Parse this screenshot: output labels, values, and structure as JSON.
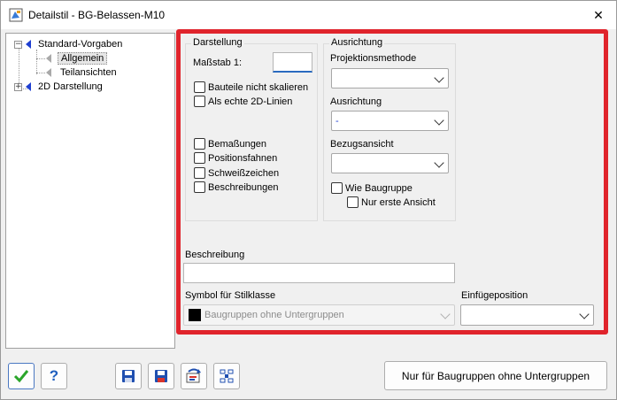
{
  "window": {
    "title": "Detailstil - BG-Belassen-M10",
    "close_glyph": "✕"
  },
  "tree": {
    "items": [
      {
        "label": "Standard-Vorgaben",
        "expander": "−"
      },
      {
        "label": "Allgemein"
      },
      {
        "label": "Teilansichten"
      },
      {
        "label": "2D Darstellung",
        "expander": "+"
      }
    ]
  },
  "darstellung": {
    "group_label": "Darstellung",
    "massstab_label": "Maßstab 1:",
    "massstab_value": "",
    "checkboxes": [
      {
        "label": "Bauteile nicht skalieren",
        "checked": false
      },
      {
        "label": "Als echte 2D-Linien",
        "checked": false
      },
      {
        "label": "Bemaßungen",
        "checked": false
      },
      {
        "label": "Positionsfahnen",
        "checked": false
      },
      {
        "label": "Schweißzeichen",
        "checked": false
      },
      {
        "label": "Beschreibungen",
        "checked": false
      }
    ]
  },
  "ausrichtung": {
    "group_label": "Ausrichtung",
    "projektionsmethode_label": "Projektionsmethode",
    "projektionsmethode_value": "",
    "ausrichtung_label": "Ausrichtung",
    "ausrichtung_value": "-",
    "bezugsansicht_label": "Bezugsansicht",
    "bezugsansicht_value": "",
    "wie_baugruppe_label": "Wie Baugruppe",
    "nur_erste_ansicht_label": "Nur erste Ansicht"
  },
  "beschreibung": {
    "label": "Beschreibung",
    "value": ""
  },
  "symbol": {
    "label": "Symbol für Stilklasse",
    "value": "Baugruppen ohne Untergruppen",
    "swatch_color": "#000000"
  },
  "einfuegeposition": {
    "label": "Einfügeposition",
    "value": ""
  },
  "footer": {
    "ok_icon": "checkmark-icon",
    "help_label": "?",
    "action_button_label": "Nur für Baugruppen ohne Untergruppen"
  },
  "colors": {
    "highlight_frame": "#e0242c",
    "tree_triangle": "#1f3fd1",
    "ok_check": "#2aa52a"
  }
}
